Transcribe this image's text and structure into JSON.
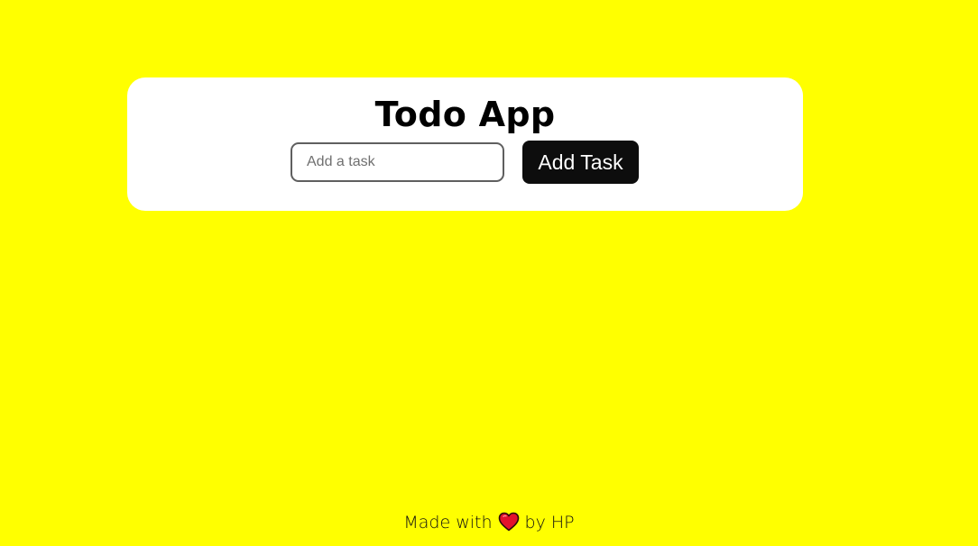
{
  "app": {
    "title": "Todo App"
  },
  "task_input": {
    "value": "",
    "placeholder": "Add a task"
  },
  "add_button": {
    "label": "Add Task"
  },
  "footer": {
    "prefix": "Made with",
    "icon": "heart-icon",
    "suffix": "by HP"
  },
  "colors": {
    "background": "#ffff00",
    "card": "#ffffff",
    "button": "#0d0d0d",
    "heart": "#e3122b"
  }
}
